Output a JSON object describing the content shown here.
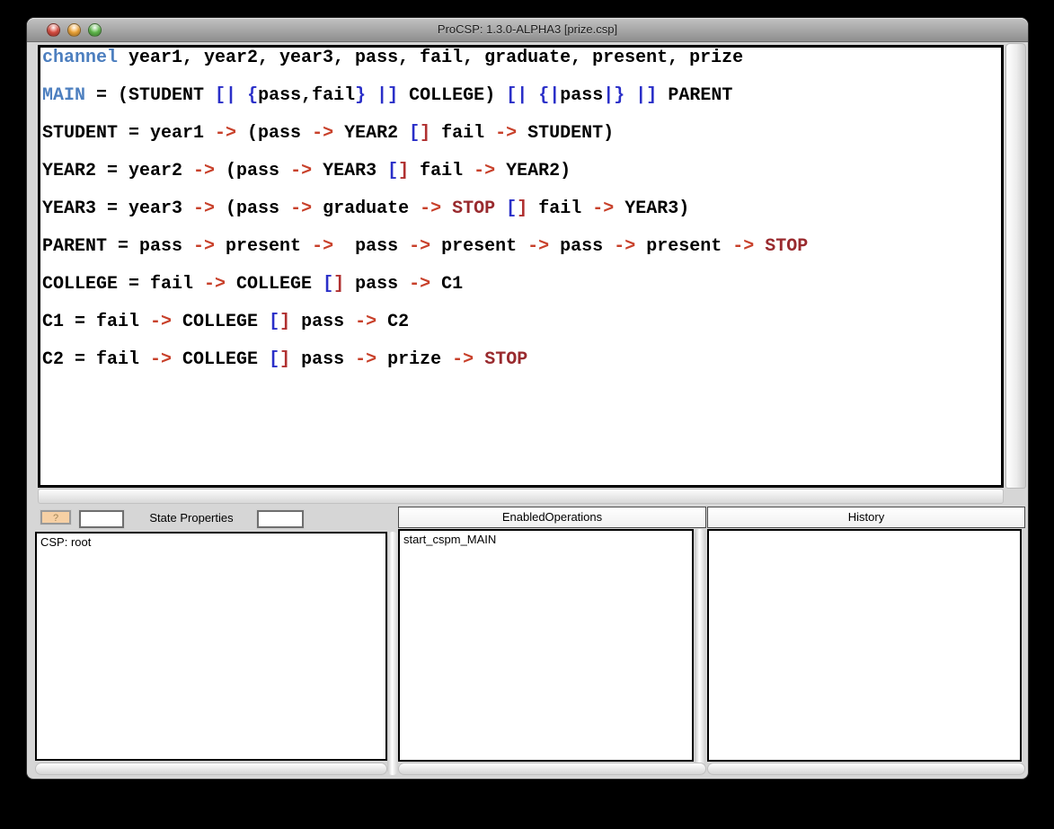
{
  "window": {
    "title": "ProCSP: 1.3.0-ALPHA3 [prize.csp]"
  },
  "editor": {
    "lines": [
      [
        {
          "t": "channel",
          "s": "kw"
        },
        {
          "t": " year1, year2, year3, pass, fail, graduate, present, prize",
          "s": "pl"
        }
      ],
      [
        {
          "t": "MAIN",
          "s": "kw"
        },
        {
          "t": " = (STUDENT ",
          "s": "pl"
        },
        {
          "t": "[|",
          "s": "bb"
        },
        {
          "t": " ",
          "s": "pl"
        },
        {
          "t": "{",
          "s": "bb"
        },
        {
          "t": "pass,fail",
          "s": "pl"
        },
        {
          "t": "}",
          "s": "bb"
        },
        {
          "t": " ",
          "s": "pl"
        },
        {
          "t": "|]",
          "s": "bb"
        },
        {
          "t": " COLLEGE) ",
          "s": "pl"
        },
        {
          "t": "[|",
          "s": "bb"
        },
        {
          "t": " ",
          "s": "pl"
        },
        {
          "t": "{|",
          "s": "bb"
        },
        {
          "t": "pass",
          "s": "pl"
        },
        {
          "t": "|}",
          "s": "bb"
        },
        {
          "t": " ",
          "s": "pl"
        },
        {
          "t": "|]",
          "s": "bb"
        },
        {
          "t": " PARENT",
          "s": "pl"
        }
      ],
      [
        {
          "t": "STUDENT = year1 ",
          "s": "pl"
        },
        {
          "t": "->",
          "s": "ar"
        },
        {
          "t": " (pass ",
          "s": "pl"
        },
        {
          "t": "->",
          "s": "ar"
        },
        {
          "t": " YEAR2 ",
          "s": "pl"
        },
        {
          "t": "[",
          "s": "bb"
        },
        {
          "t": "]",
          "s": "br"
        },
        {
          "t": " fail ",
          "s": "pl"
        },
        {
          "t": "->",
          "s": "ar"
        },
        {
          "t": " STUDENT)",
          "s": "pl"
        }
      ],
      [
        {
          "t": "YEAR2 = year2 ",
          "s": "pl"
        },
        {
          "t": "->",
          "s": "ar"
        },
        {
          "t": " (pass ",
          "s": "pl"
        },
        {
          "t": "->",
          "s": "ar"
        },
        {
          "t": " YEAR3 ",
          "s": "pl"
        },
        {
          "t": "[",
          "s": "bb"
        },
        {
          "t": "]",
          "s": "br"
        },
        {
          "t": " fail ",
          "s": "pl"
        },
        {
          "t": "->",
          "s": "ar"
        },
        {
          "t": " YEAR2)",
          "s": "pl"
        }
      ],
      [
        {
          "t": "YEAR3 = year3 ",
          "s": "pl"
        },
        {
          "t": "->",
          "s": "ar"
        },
        {
          "t": " (pass ",
          "s": "pl"
        },
        {
          "t": "->",
          "s": "ar"
        },
        {
          "t": " graduate ",
          "s": "pl"
        },
        {
          "t": "->",
          "s": "ar"
        },
        {
          "t": " ",
          "s": "pl"
        },
        {
          "t": "STOP",
          "s": "st"
        },
        {
          "t": " ",
          "s": "pl"
        },
        {
          "t": "[",
          "s": "bb"
        },
        {
          "t": "]",
          "s": "br"
        },
        {
          "t": " fail ",
          "s": "pl"
        },
        {
          "t": "->",
          "s": "ar"
        },
        {
          "t": " YEAR3)",
          "s": "pl"
        }
      ],
      [
        {
          "t": "PARENT = pass ",
          "s": "pl"
        },
        {
          "t": "->",
          "s": "ar"
        },
        {
          "t": " present ",
          "s": "pl"
        },
        {
          "t": "->",
          "s": "ar"
        },
        {
          "t": "  pass ",
          "s": "pl"
        },
        {
          "t": "->",
          "s": "ar"
        },
        {
          "t": " present ",
          "s": "pl"
        },
        {
          "t": "->",
          "s": "ar"
        },
        {
          "t": " pass ",
          "s": "pl"
        },
        {
          "t": "->",
          "s": "ar"
        },
        {
          "t": " present ",
          "s": "pl"
        },
        {
          "t": "->",
          "s": "ar"
        },
        {
          "t": " ",
          "s": "pl"
        },
        {
          "t": "STOP",
          "s": "st"
        }
      ],
      [
        {
          "t": "COLLEGE = fail ",
          "s": "pl"
        },
        {
          "t": "->",
          "s": "ar"
        },
        {
          "t": " COLLEGE ",
          "s": "pl"
        },
        {
          "t": "[",
          "s": "bb"
        },
        {
          "t": "]",
          "s": "br"
        },
        {
          "t": " pass ",
          "s": "pl"
        },
        {
          "t": "->",
          "s": "ar"
        },
        {
          "t": " C1",
          "s": "pl"
        }
      ],
      [
        {
          "t": "C1 = fail ",
          "s": "pl"
        },
        {
          "t": "->",
          "s": "ar"
        },
        {
          "t": " COLLEGE ",
          "s": "pl"
        },
        {
          "t": "[",
          "s": "bb"
        },
        {
          "t": "]",
          "s": "br"
        },
        {
          "t": " pass ",
          "s": "pl"
        },
        {
          "t": "->",
          "s": "ar"
        },
        {
          "t": " C2",
          "s": "pl"
        }
      ],
      [
        {
          "t": "C2 = fail ",
          "s": "pl"
        },
        {
          "t": "->",
          "s": "ar"
        },
        {
          "t": " COLLEGE ",
          "s": "pl"
        },
        {
          "t": "[",
          "s": "bb"
        },
        {
          "t": "]",
          "s": "br"
        },
        {
          "t": " pass ",
          "s": "pl"
        },
        {
          "t": "->",
          "s": "ar"
        },
        {
          "t": " prize ",
          "s": "pl"
        },
        {
          "t": "->",
          "s": "ar"
        },
        {
          "t": " ",
          "s": "pl"
        },
        {
          "t": "STOP",
          "s": "st"
        }
      ]
    ]
  },
  "panels": {
    "state_properties": {
      "title": "State Properties",
      "help_button_label": "?",
      "items": [
        "CSP: root"
      ]
    },
    "enabled_operations": {
      "title": "EnabledOperations",
      "items": [
        "start_cspm_MAIN"
      ]
    },
    "history": {
      "title": "History",
      "items": []
    }
  },
  "colors": {
    "keyword_blue": "#4d7fbf",
    "plain_text": "#000000",
    "arrow_red": "#c8402a",
    "stop_maroon": "#992a2e",
    "bracket_blue": "#2a2fc8",
    "bracket_red": "#b03030",
    "help_indicator_bg": "#f6d0a4",
    "traffic_close": "#dd4f43",
    "traffic_minimize": "#f2a83a",
    "traffic_zoom": "#62bd4e",
    "titlebar_top": "#c2c2c2",
    "titlebar_bottom": "#8e8e8e",
    "window_bg": "#d6d6d6"
  }
}
